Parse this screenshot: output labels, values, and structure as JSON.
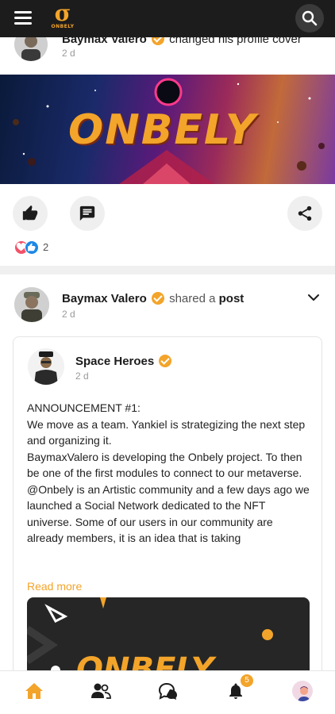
{
  "header": {
    "logo_mark": "σ",
    "logo_text": "ONBELY"
  },
  "post1": {
    "author": "Baymax Valero",
    "action": "changed his profile cover",
    "time": "2 d",
    "cover_text": "ONBELY",
    "reaction_count": "2"
  },
  "post2": {
    "author": "Baymax Valero",
    "verb": "shared a",
    "object": "post",
    "time": "2 d",
    "shared": {
      "author": "Space Heroes",
      "time": "2 d",
      "body": [
        "ANNOUNCEMENT #1:",
        "We move as a team. Yankiel is strategizing the next step and organizing it.",
        "BaymaxValero is developing the Onbely project. To then be one of the first modules to connect to our metaverse.",
        "@Onbely is an Artistic community and a few days ago we launched a Social Network dedicated to the NFT universe. Some of our users in our community are already members, it is an idea that is taking"
      ],
      "read_more": "Read more",
      "image_text": "ONBELY"
    }
  },
  "bottom_nav": {
    "notifications_badge": "5"
  },
  "colors": {
    "accent": "#f3a42a",
    "topbar": "#1c1c1c"
  }
}
